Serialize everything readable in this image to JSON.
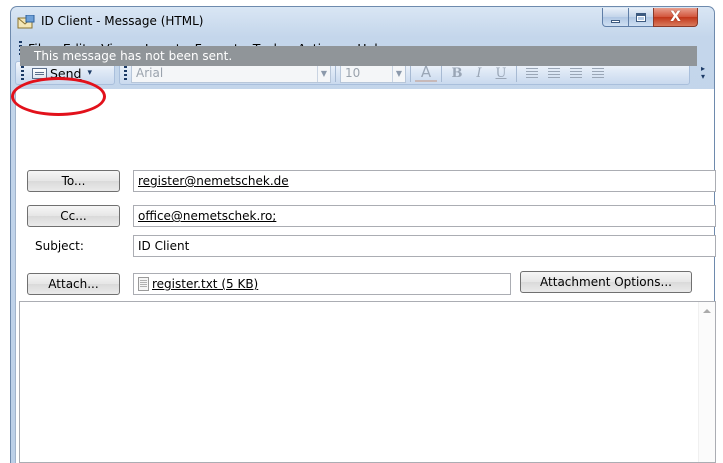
{
  "window": {
    "title": "ID Client - Message (HTML)",
    "close_symbol": "X"
  },
  "menu": {
    "file": "File",
    "edit": "Edit",
    "view": "View",
    "insert": "Insert",
    "format": "Format",
    "tools": "Tools",
    "actions": "Actions",
    "help": "Help"
  },
  "toolbar": {
    "send_label": "Send",
    "font_name": "Arial",
    "font_size": "10"
  },
  "banner": "This message has not been sent.",
  "header_fields": {
    "to_button": "To...",
    "to_value": "register@nemetschek.de",
    "cc_button": "Cc...",
    "cc_value": "office@nemetschek.ro;",
    "subject_label": "Subject:",
    "subject_value": "ID Client",
    "attach_button": "Attach...",
    "attachment_name": "register.txt (5 KB)",
    "attachment_options_button": "Attachment Options..."
  },
  "icons": {
    "app": "message-envelope-icon",
    "send": "envelope-icon",
    "attachment": "text-file-icon"
  },
  "colors": {
    "banner_bg": "#909599",
    "highlight_ellipse": "#e2111b",
    "close_button": "#c1361a"
  }
}
